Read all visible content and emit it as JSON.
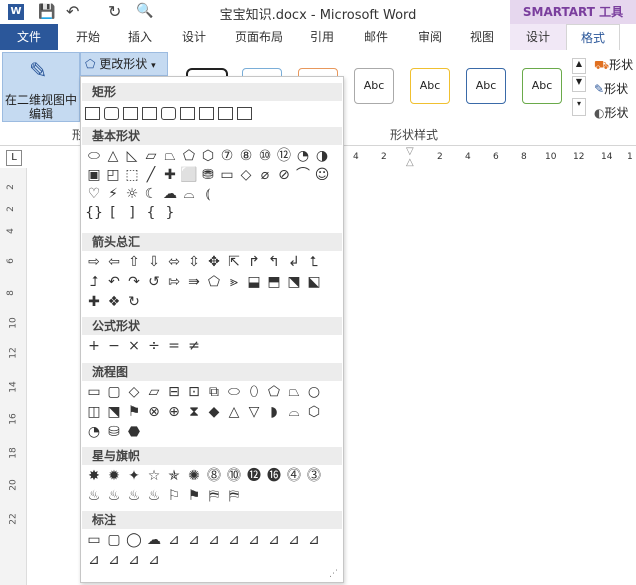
{
  "window": {
    "title": "宝宝知识.docx - Microsoft Word",
    "context_tab_group": "SMARTART 工具"
  },
  "tabs": [
    {
      "label": "文件"
    },
    {
      "label": "开始"
    },
    {
      "label": "插入"
    },
    {
      "label": "设计"
    },
    {
      "label": "页面布局"
    },
    {
      "label": "引用"
    },
    {
      "label": "邮件"
    },
    {
      "label": "审阅"
    },
    {
      "label": "视图"
    },
    {
      "label": "设计"
    },
    {
      "label": "格式"
    }
  ],
  "ribbon": {
    "edit_2d_label": "在二维视图中编辑",
    "change_shape_label": "更改形状",
    "group_left_label": "形",
    "shape_styles_label": "形状样式",
    "style_sample_text": "Abc",
    "right_items": [
      "形状",
      "形状",
      "形状"
    ]
  },
  "ruler": {
    "corner": "L",
    "h_ticks": [
      "4",
      "2",
      "2",
      "4",
      "6",
      "8",
      "10",
      "12",
      "14",
      "1"
    ],
    "v_ticks": [
      "2",
      "2",
      "4",
      "6",
      "8",
      "10",
      "12",
      "14",
      "16",
      "18",
      "20",
      "22"
    ]
  },
  "gallery": {
    "sections": [
      "矩形",
      "基本形状",
      "箭头总汇",
      "公式形状",
      "流程图",
      "星与旗帜",
      "标注"
    ],
    "basic_symbols": [
      "{}",
      "[",
      "]",
      "{",
      "}"
    ],
    "star_labels": [
      "8",
      "10",
      "12",
      "16",
      "24",
      "32"
    ],
    "arrow_glyphs": [
      "⇨",
      "⇦",
      "⇧",
      "⇩",
      "⬄",
      "⇳",
      "✥",
      "⇱",
      "↱",
      "↰",
      "↲",
      "⮤",
      "⮥",
      "↶",
      "↷",
      "↺",
      "⇰",
      "⇛",
      "⬠",
      "⪢",
      "⬓",
      "⬒",
      "⬔",
      "⬕",
      "✚",
      "❖",
      "↻"
    ],
    "formula_glyphs": [
      "+",
      "−",
      "×",
      "÷",
      "=",
      "≠"
    ],
    "basic_glyphs": [
      "⬭",
      "△",
      "◺",
      "▱",
      "⏢",
      "⬠",
      "⬡",
      "⑦",
      "⑧",
      "⑩",
      "⑫",
      "◔",
      "◑",
      "▣",
      "◰",
      "⬚",
      "╱",
      "✚",
      "⬜",
      "⛃",
      "▭",
      "◇",
      "⌀",
      "⊘",
      "⌒",
      "☺",
      "♡",
      "⚡",
      "☼",
      "☾",
      "☁",
      "⌓",
      "⦅"
    ],
    "flow_glyphs": [
      "▭",
      "▢",
      "◇",
      "▱",
      "⊟",
      "⊡",
      "⧉",
      "⬭",
      "⬯",
      "⬠",
      "⏢",
      "○",
      "◫",
      "⬔",
      "⚑",
      "⊗",
      "⊕",
      "⧗",
      "◆",
      "△",
      "▽",
      "◗",
      "⌓",
      "⬡",
      "◔",
      "⛁",
      "⬣"
    ],
    "star_glyphs": [
      "✸",
      "✹",
      "✦",
      "☆",
      "✯",
      "✺",
      "⓼",
      "⓾",
      "⓬",
      "⓰",
      "⓸",
      "⓷",
      "♨",
      "♨",
      "♨",
      "♨",
      "⚐",
      "⚑",
      "⛿",
      "⛿"
    ],
    "callout_glyphs": [
      "▭",
      "▢",
      "◯",
      "☁",
      "⊿",
      "⊿",
      "⊿",
      "⊿",
      "⊿",
      "⊿",
      "⊿",
      "⊿",
      "⊿",
      "⊿",
      "⊿",
      "⊿"
    ]
  },
  "colors": {
    "file_tab": "#2b579a",
    "smartart": "#7a3e9d",
    "ribbon_select": "#c5daf1"
  }
}
